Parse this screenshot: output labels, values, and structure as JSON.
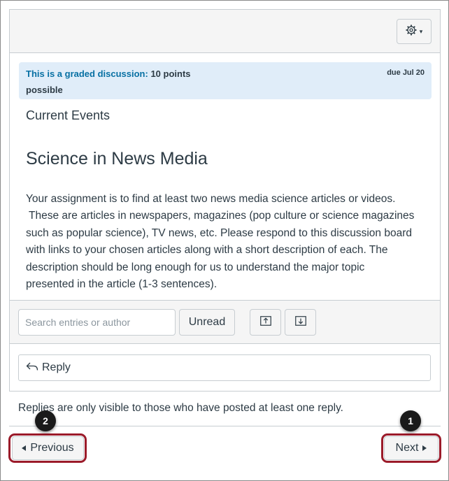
{
  "toolbar": {
    "settings_icon": "gear-icon",
    "settings_caret": "▾"
  },
  "graded_banner": {
    "link_text": "This is a graded discussion:",
    "points_text": "10 points",
    "possible_text": "possible",
    "due_text": "due Jul 20"
  },
  "content": {
    "section_title": "Current Events",
    "heading": "Science in News Media",
    "body_lines": [
      "Your assignment is to find at least two news media science articles or videos.",
      " These are articles in newspapers, magazines (pop culture or science magazines",
      "such as popular science), TV news, etc.  Please respond to this discussion board",
      "with links to your chosen articles along with a short description of each.  The",
      "description should be long enough for us to understand the major topic",
      "presented in the article (1-3 sentences)."
    ]
  },
  "filters": {
    "search_placeholder": "Search entries or author",
    "search_value": "",
    "unread_label": "Unread",
    "collapse_icon": "arrow-up-tray-icon",
    "expand_icon": "arrow-down-tray-icon"
  },
  "reply": {
    "label": "Reply",
    "icon": "reply-arrow-icon"
  },
  "notice": "Replies are only visible to those who have posted at least one reply.",
  "nav": {
    "previous_label": "Previous",
    "next_label": "Next"
  },
  "callouts": {
    "next": "1",
    "previous": "2"
  },
  "colors": {
    "link": "#0770a3",
    "banner_bg": "#e0edf9",
    "highlight": "#9b1b2a",
    "callout_bg": "#1a1a1a"
  }
}
